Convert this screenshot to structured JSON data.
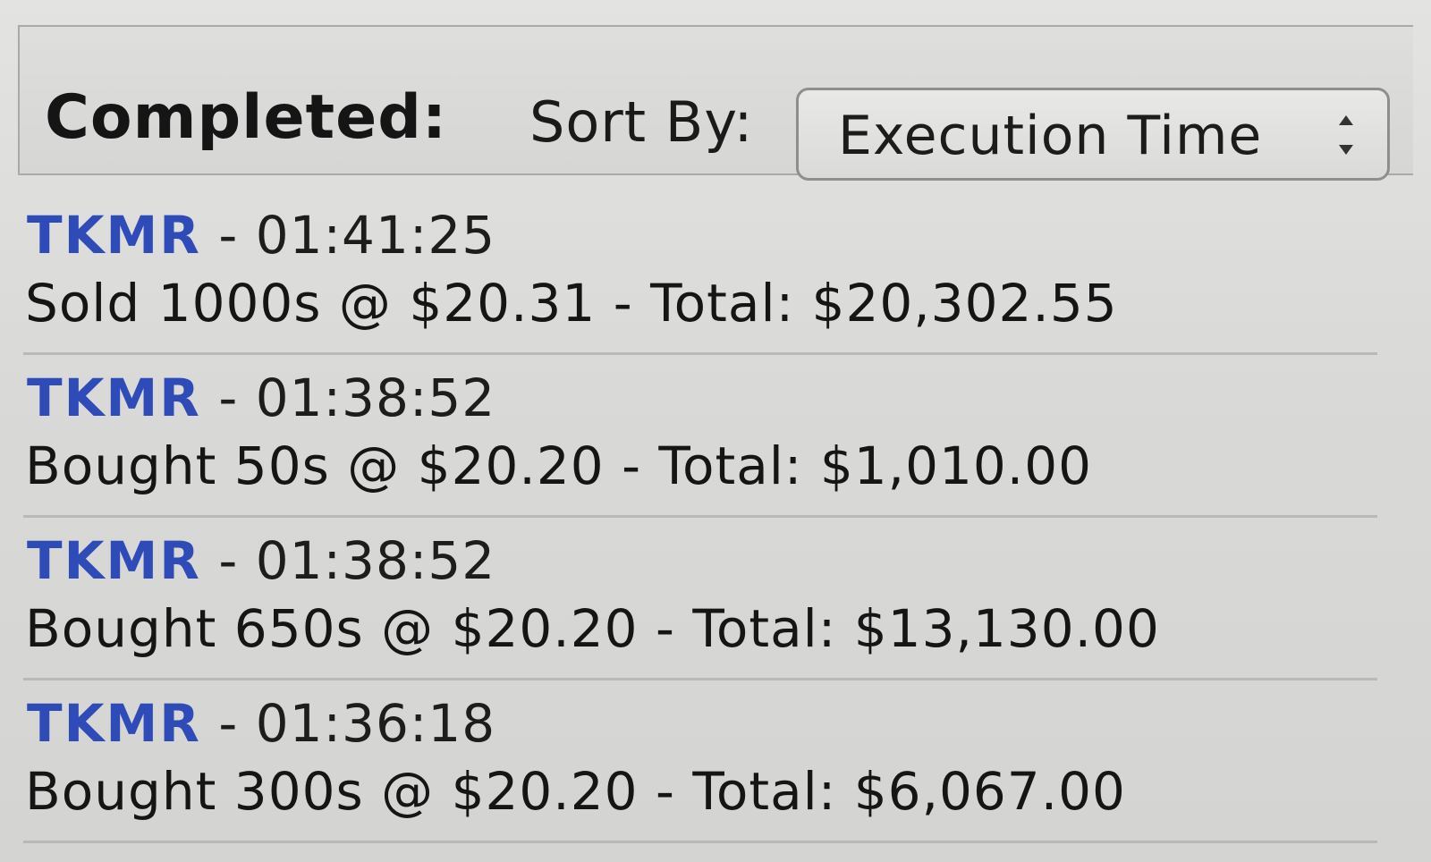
{
  "header": {
    "title": "Completed:",
    "sort_label": "Sort By:",
    "sort_value": "Execution Time"
  },
  "orders": [
    {
      "symbol": "TKMR",
      "time": " - 01:41:25",
      "detail": "Sold 1000s @ $20.31 - Total: $20,302.55"
    },
    {
      "symbol": "TKMR",
      "time": " - 01:38:52",
      "detail": "Bought 50s @ $20.20 - Total: $1,010.00"
    },
    {
      "symbol": "TKMR",
      "time": " - 01:38:52",
      "detail": "Bought 650s @ $20.20 - Total: $13,130.00"
    },
    {
      "symbol": "TKMR",
      "time": " - 01:36:18",
      "detail": "Bought 300s @ $20.20 - Total: $6,067.00"
    }
  ],
  "colors": {
    "symbol": "#2f4bb8",
    "background": "#dcdcda"
  },
  "icons": {
    "sort_select": "up-down-arrows-icon"
  }
}
